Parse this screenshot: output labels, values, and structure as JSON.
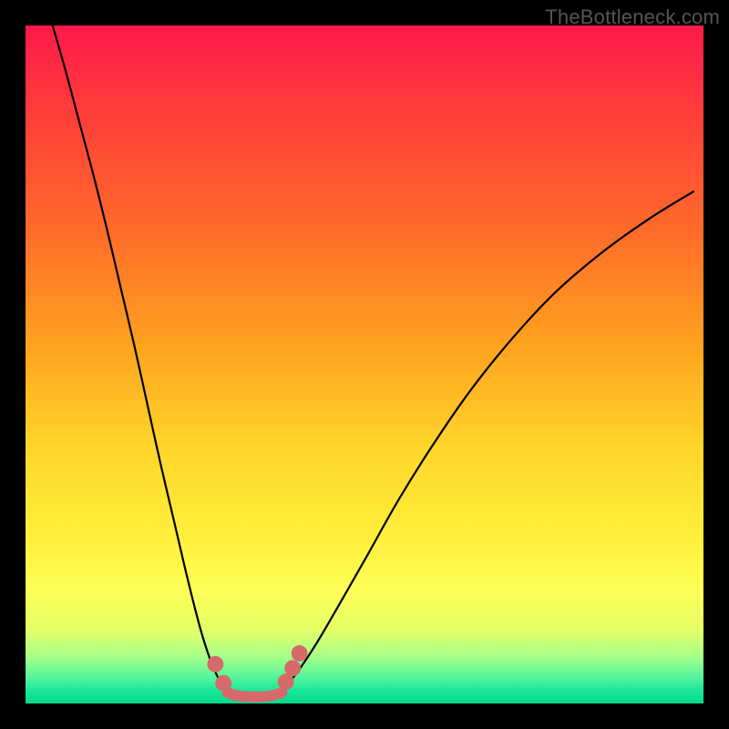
{
  "watermark": "TheBottleneck.com",
  "chart_data": {
    "type": "line",
    "title": "",
    "xlabel": "",
    "ylabel": "",
    "xlim": [
      0,
      1
    ],
    "ylim": [
      0,
      1
    ],
    "grid": false,
    "legend": false,
    "series": [
      {
        "name": "left-branch",
        "stroke": "#000000",
        "x": [
          0.04,
          0.06,
          0.08,
          0.1,
          0.12,
          0.14,
          0.16,
          0.18,
          0.2,
          0.22,
          0.24,
          0.258,
          0.272,
          0.284,
          0.294
        ],
        "y": [
          1.0,
          0.93,
          0.855,
          0.78,
          0.7,
          0.615,
          0.53,
          0.44,
          0.35,
          0.265,
          0.18,
          0.11,
          0.066,
          0.038,
          0.022
        ]
      },
      {
        "name": "right-branch",
        "stroke": "#000000",
        "x": [
          0.38,
          0.4,
          0.43,
          0.465,
          0.505,
          0.55,
          0.6,
          0.655,
          0.715,
          0.78,
          0.85,
          0.92,
          0.985
        ],
        "y": [
          0.022,
          0.045,
          0.09,
          0.15,
          0.22,
          0.3,
          0.38,
          0.46,
          0.535,
          0.605,
          0.665,
          0.715,
          0.755
        ]
      },
      {
        "name": "trough-floor",
        "stroke": "#d66a6a",
        "x": [
          0.298,
          0.31,
          0.328,
          0.35,
          0.365,
          0.378
        ],
        "y": [
          0.016,
          0.012,
          0.01,
          0.01,
          0.012,
          0.016
        ]
      }
    ],
    "markers": [
      {
        "name": "left-dot-upper",
        "x": 0.28,
        "y": 0.058,
        "r": 0.012,
        "fill": "#d66a6a"
      },
      {
        "name": "left-dot-lower",
        "x": 0.292,
        "y": 0.03,
        "r": 0.012,
        "fill": "#d66a6a"
      },
      {
        "name": "right-dot-lower",
        "x": 0.384,
        "y": 0.032,
        "r": 0.012,
        "fill": "#d66a6a"
      },
      {
        "name": "right-dot-mid",
        "x": 0.394,
        "y": 0.052,
        "r": 0.012,
        "fill": "#d66a6a"
      },
      {
        "name": "right-dot-upper",
        "x": 0.404,
        "y": 0.074,
        "r": 0.012,
        "fill": "#d66a6a"
      }
    ]
  }
}
